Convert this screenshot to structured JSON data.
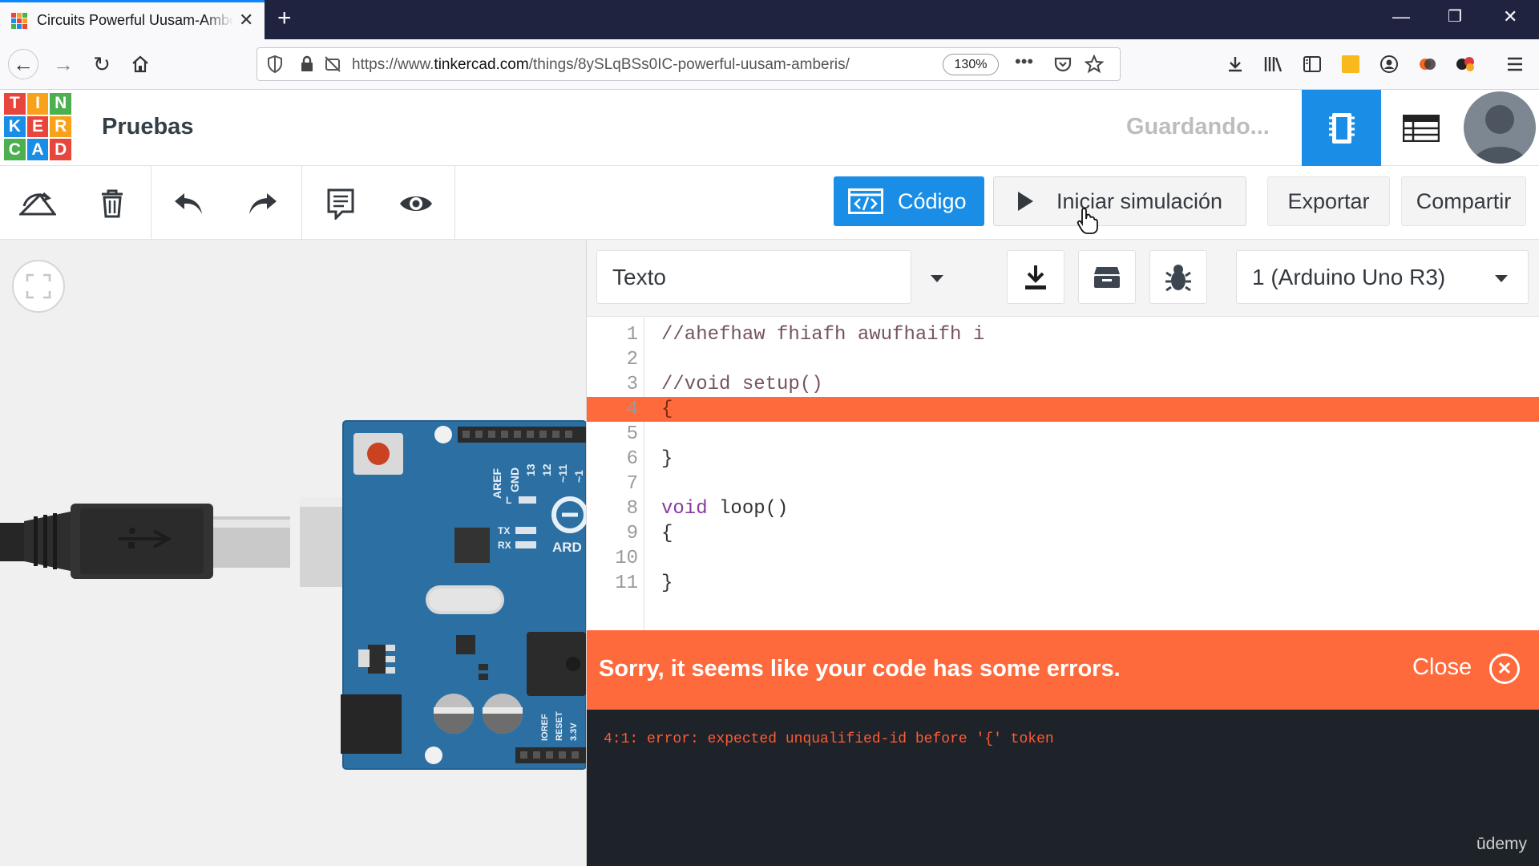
{
  "browser": {
    "tab_title": "Circuits Powerful Uusam-Amberis",
    "url_prefix": "https://www.",
    "url_domain": "tinkercad.com",
    "url_path": "/things/8ySLqBSs0IC-powerful-uusam-amberis/",
    "zoom": "130%",
    "new_tab": "+",
    "overflow_menu": "•••"
  },
  "logo": {
    "letters": [
      "T",
      "I",
      "N",
      "K",
      "E",
      "R",
      "C",
      "A",
      "D"
    ],
    "colors": [
      "#e8453c",
      "#f9a11b",
      "#4caf50",
      "#1a8ee6",
      "#e8453c",
      "#f9a11b",
      "#4caf50",
      "#1a8ee6",
      "#e8453c"
    ]
  },
  "header": {
    "project_name": "Pruebas",
    "saving_status": "Guardando..."
  },
  "toolbar": {
    "code_button": "Código",
    "simulate_button": "Iniciar simulación",
    "export_button": "Exportar",
    "share_button": "Compartir"
  },
  "code_panel": {
    "mode_select": "Texto",
    "board_select": "1 (Arduino Uno R3)",
    "lines": [
      {
        "n": "1",
        "text": "//ahefhaw fhiafh awufhaifh i",
        "cls": "tk-comment"
      },
      {
        "n": "2",
        "text": "",
        "cls": "tk-plain"
      },
      {
        "n": "3",
        "text": "//void setup()",
        "cls": "tk-comment"
      },
      {
        "n": "4",
        "text": "{",
        "cls": "tk-plain"
      },
      {
        "n": "5",
        "text": "",
        "cls": "tk-plain"
      },
      {
        "n": "6",
        "text": "}",
        "cls": "tk-plain"
      },
      {
        "n": "7",
        "text": "",
        "cls": "tk-plain"
      },
      {
        "n": "8",
        "text": "void loop()",
        "cls": "tk-plain"
      },
      {
        "n": "9",
        "text": "{",
        "cls": "tk-plain"
      },
      {
        "n": "10",
        "text": "",
        "cls": "tk-plain"
      },
      {
        "n": "11",
        "text": "}",
        "cls": "tk-plain"
      }
    ],
    "error_line": "4",
    "error_banner": "Sorry, it seems like your code has some errors.",
    "close_label": "Close",
    "console_output": "4:1: error: expected unqualified-id before '{' token",
    "watermark": "ūdemy"
  },
  "board_labels": {
    "aref": "AREF",
    "gnd": "GND",
    "d13": "13",
    "d12": "12",
    "d11": "~11",
    "d10": "~1",
    "l": "L",
    "tx": "TX",
    "rx": "RX",
    "brand": "ARD",
    "ioref": "IOREF",
    "reset": "RESET",
    "v33": "3.3V"
  },
  "colors": {
    "accent": "#1a8ee6",
    "error": "#ff6a3d",
    "console_bg": "#1d2329",
    "board": "#2b6fa3"
  }
}
